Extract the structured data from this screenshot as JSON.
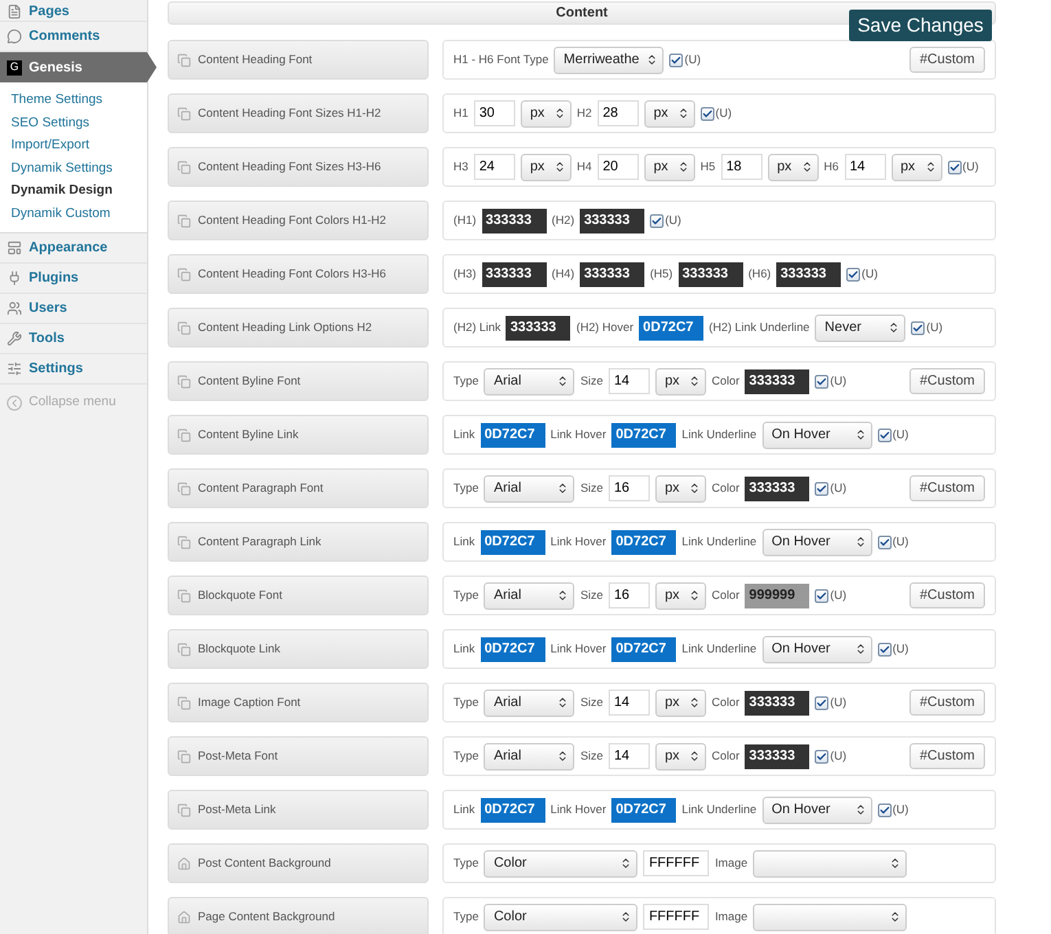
{
  "sidebar": {
    "items": [
      {
        "kind": "pages",
        "label": "Pages",
        "selected": false
      },
      {
        "kind": "comments",
        "label": "Comments",
        "selected": false
      },
      {
        "kind": "genesis",
        "label": "Genesis",
        "selected": true,
        "badge": "G",
        "children": [
          {
            "label": "Theme Settings",
            "selected": false
          },
          {
            "label": "SEO Settings",
            "selected": false
          },
          {
            "label": "Import/Export",
            "selected": false
          },
          {
            "label": "Dynamik Settings",
            "selected": false
          },
          {
            "label": "Dynamik Design",
            "selected": true
          },
          {
            "label": "Dynamik Custom",
            "selected": false
          }
        ]
      },
      {
        "kind": "appearance",
        "label": "Appearance",
        "selected": false
      },
      {
        "kind": "plugins",
        "label": "Plugins",
        "selected": false
      },
      {
        "kind": "users",
        "label": "Users",
        "selected": false
      },
      {
        "kind": "tools",
        "label": "Tools",
        "selected": false
      },
      {
        "kind": "settings",
        "label": "Settings",
        "selected": false
      }
    ],
    "collapse": "Collapse menu"
  },
  "section": {
    "title": "Content"
  },
  "save_button": "Save Changes",
  "rows": [
    {
      "kind": "font",
      "label": "Content Heading Font",
      "controls": [
        {
          "kind": "text",
          "text": "H1 - H6 Font Type"
        },
        {
          "kind": "select",
          "value": "Merriweathe"
        },
        {
          "kind": "checkbox",
          "checked": true,
          "label": "(U)"
        },
        {
          "kind": "button",
          "text": "#Custom"
        }
      ]
    },
    {
      "kind": "font",
      "label": "Content Heading Font Sizes H1-H2",
      "controls": [
        {
          "kind": "text",
          "text": "H1"
        },
        {
          "kind": "number",
          "value": "30"
        },
        {
          "kind": "unit-select",
          "value": "px"
        },
        {
          "kind": "text",
          "text": "H2"
        },
        {
          "kind": "number",
          "value": "28"
        },
        {
          "kind": "unit-select",
          "value": "px"
        },
        {
          "kind": "checkbox",
          "checked": true,
          "label": "(U)"
        }
      ]
    },
    {
      "kind": "font",
      "label": "Content Heading Font Sizes H3-H6",
      "controls": [
        {
          "kind": "text",
          "text": "H3"
        },
        {
          "kind": "number",
          "value": "24"
        },
        {
          "kind": "unit-select",
          "value": "px"
        },
        {
          "kind": "text",
          "text": "H4"
        },
        {
          "kind": "number",
          "value": "20"
        },
        {
          "kind": "unit-select",
          "value": "px"
        },
        {
          "kind": "text",
          "text": "H5"
        },
        {
          "kind": "number",
          "value": "18"
        },
        {
          "kind": "unit-select",
          "value": "px"
        },
        {
          "kind": "text",
          "text": "H6"
        },
        {
          "kind": "number",
          "value": "14"
        },
        {
          "kind": "unit-select",
          "value": "px"
        },
        {
          "kind": "checkbox",
          "checked": true,
          "label": "(U)"
        }
      ]
    },
    {
      "kind": "font",
      "label": "Content Heading Font Colors H1-H2",
      "controls": [
        {
          "kind": "text",
          "text": "(H1)"
        },
        {
          "kind": "color",
          "value": "333333",
          "color": "#333333"
        },
        {
          "kind": "text",
          "text": "(H2)"
        },
        {
          "kind": "color",
          "value": "333333",
          "color": "#333333"
        },
        {
          "kind": "checkbox",
          "checked": true,
          "label": "(U)"
        }
      ]
    },
    {
      "kind": "font",
      "label": "Content Heading Font Colors H3-H6",
      "controls": [
        {
          "kind": "text",
          "text": "(H3)"
        },
        {
          "kind": "color",
          "value": "333333",
          "color": "#333333"
        },
        {
          "kind": "text",
          "text": "(H4)"
        },
        {
          "kind": "color",
          "value": "333333",
          "color": "#333333"
        },
        {
          "kind": "text",
          "text": "(H5)"
        },
        {
          "kind": "color",
          "value": "333333",
          "color": "#333333"
        },
        {
          "kind": "text",
          "text": "(H6)"
        },
        {
          "kind": "color",
          "value": "333333",
          "color": "#333333"
        },
        {
          "kind": "checkbox",
          "checked": true,
          "label": "(U)"
        }
      ]
    },
    {
      "kind": "font",
      "label": "Content Heading Link Options H2",
      "controls": [
        {
          "kind": "text",
          "text": "(H2) Link"
        },
        {
          "kind": "color",
          "value": "333333",
          "color": "#333333"
        },
        {
          "kind": "text",
          "text": "(H2) Hover"
        },
        {
          "kind": "color",
          "value": "0D72C7",
          "color": "#0d72c7"
        },
        {
          "kind": "text",
          "text": "(H2) Link Underline"
        },
        {
          "kind": "select",
          "value": "Never"
        },
        {
          "kind": "checkbox",
          "checked": true,
          "label": "(U)"
        }
      ]
    },
    {
      "kind": "font",
      "label": "Content Byline Font",
      "controls": [
        {
          "kind": "text",
          "text": "Type"
        },
        {
          "kind": "select",
          "value": "Arial"
        },
        {
          "kind": "text",
          "text": "Size"
        },
        {
          "kind": "number",
          "value": "14"
        },
        {
          "kind": "unit-select",
          "value": "px"
        },
        {
          "kind": "text",
          "text": "Color"
        },
        {
          "kind": "color",
          "value": "333333",
          "color": "#333333"
        },
        {
          "kind": "checkbox",
          "checked": true,
          "label": "(U)"
        },
        {
          "kind": "button",
          "text": "#Custom"
        }
      ]
    },
    {
      "kind": "font",
      "label": "Content Byline Link",
      "controls": [
        {
          "kind": "text",
          "text": "Link"
        },
        {
          "kind": "color",
          "value": "0D72C7",
          "color": "#0d72c7"
        },
        {
          "kind": "text",
          "text": "Link Hover"
        },
        {
          "kind": "color",
          "value": "0D72C7",
          "color": "#0d72c7"
        },
        {
          "kind": "text",
          "text": "Link Underline"
        },
        {
          "kind": "select",
          "value": "On Hover"
        },
        {
          "kind": "checkbox",
          "checked": true,
          "label": "(U)"
        }
      ]
    },
    {
      "kind": "font",
      "label": "Content Paragraph Font",
      "controls": [
        {
          "kind": "text",
          "text": "Type"
        },
        {
          "kind": "select",
          "value": "Arial"
        },
        {
          "kind": "text",
          "text": "Size"
        },
        {
          "kind": "number",
          "value": "16"
        },
        {
          "kind": "unit-select",
          "value": "px"
        },
        {
          "kind": "text",
          "text": "Color"
        },
        {
          "kind": "color",
          "value": "333333",
          "color": "#333333"
        },
        {
          "kind": "checkbox",
          "checked": true,
          "label": "(U)"
        },
        {
          "kind": "button",
          "text": "#Custom"
        }
      ]
    },
    {
      "kind": "font",
      "label": "Content Paragraph Link",
      "controls": [
        {
          "kind": "text",
          "text": "Link"
        },
        {
          "kind": "color",
          "value": "0D72C7",
          "color": "#0d72c7"
        },
        {
          "kind": "text",
          "text": "Link Hover"
        },
        {
          "kind": "color",
          "value": "0D72C7",
          "color": "#0d72c7"
        },
        {
          "kind": "text",
          "text": "Link Underline"
        },
        {
          "kind": "select",
          "value": "On Hover"
        },
        {
          "kind": "checkbox",
          "checked": true,
          "label": "(U)"
        }
      ]
    },
    {
      "kind": "font",
      "label": "Blockquote Font",
      "controls": [
        {
          "kind": "text",
          "text": "Type"
        },
        {
          "kind": "select",
          "value": "Arial"
        },
        {
          "kind": "text",
          "text": "Size"
        },
        {
          "kind": "number",
          "value": "16"
        },
        {
          "kind": "unit-select",
          "value": "px"
        },
        {
          "kind": "text",
          "text": "Color"
        },
        {
          "kind": "color",
          "value": "999999",
          "color": "#999999"
        },
        {
          "kind": "checkbox",
          "checked": true,
          "label": "(U)"
        },
        {
          "kind": "button",
          "text": "#Custom"
        }
      ]
    },
    {
      "kind": "font",
      "label": "Blockquote Link",
      "controls": [
        {
          "kind": "text",
          "text": "Link"
        },
        {
          "kind": "color",
          "value": "0D72C7",
          "color": "#0d72c7"
        },
        {
          "kind": "text",
          "text": "Link Hover"
        },
        {
          "kind": "color",
          "value": "0D72C7",
          "color": "#0d72c7"
        },
        {
          "kind": "text",
          "text": "Link Underline"
        },
        {
          "kind": "select",
          "value": "On Hover"
        },
        {
          "kind": "checkbox",
          "checked": true,
          "label": "(U)"
        }
      ]
    },
    {
      "kind": "font",
      "label": "Image Caption Font",
      "controls": [
        {
          "kind": "text",
          "text": "Type"
        },
        {
          "kind": "select",
          "value": "Arial"
        },
        {
          "kind": "text",
          "text": "Size"
        },
        {
          "kind": "number",
          "value": "14"
        },
        {
          "kind": "unit-select",
          "value": "px"
        },
        {
          "kind": "text",
          "text": "Color"
        },
        {
          "kind": "color",
          "value": "333333",
          "color": "#333333"
        },
        {
          "kind": "checkbox",
          "checked": true,
          "label": "(U)"
        },
        {
          "kind": "button",
          "text": "#Custom"
        }
      ]
    },
    {
      "kind": "font",
      "label": "Post-Meta Font",
      "controls": [
        {
          "kind": "text",
          "text": "Type"
        },
        {
          "kind": "select",
          "value": "Arial"
        },
        {
          "kind": "text",
          "text": "Size"
        },
        {
          "kind": "number",
          "value": "14"
        },
        {
          "kind": "unit-select",
          "value": "px"
        },
        {
          "kind": "text",
          "text": "Color"
        },
        {
          "kind": "color",
          "value": "333333",
          "color": "#333333"
        },
        {
          "kind": "checkbox",
          "checked": true,
          "label": "(U)"
        },
        {
          "kind": "button",
          "text": "#Custom"
        }
      ]
    },
    {
      "kind": "font",
      "label": "Post-Meta Link",
      "controls": [
        {
          "kind": "text",
          "text": "Link"
        },
        {
          "kind": "color",
          "value": "0D72C7",
          "color": "#0d72c7"
        },
        {
          "kind": "text",
          "text": "Link Hover"
        },
        {
          "kind": "color",
          "value": "0D72C7",
          "color": "#0d72c7"
        },
        {
          "kind": "text",
          "text": "Link Underline"
        },
        {
          "kind": "select",
          "value": "On Hover"
        },
        {
          "kind": "checkbox",
          "checked": true,
          "label": "(U)"
        }
      ]
    },
    {
      "kind": "background",
      "label": "Post Content Background",
      "controls": [
        {
          "kind": "text",
          "text": "Type"
        },
        {
          "kind": "wide-select",
          "value": "Color"
        },
        {
          "kind": "hex",
          "value": "FFFFFF"
        },
        {
          "kind": "text",
          "text": "Image"
        },
        {
          "kind": "wide-select"
        }
      ]
    },
    {
      "kind": "background",
      "label": "Page Content Background",
      "controls": [
        {
          "kind": "text",
          "text": "Type"
        },
        {
          "kind": "wide-select",
          "value": "Color"
        },
        {
          "kind": "hex",
          "value": "FFFFFF"
        },
        {
          "kind": "text",
          "text": "Image"
        },
        {
          "kind": "wide-select"
        }
      ]
    }
  ]
}
